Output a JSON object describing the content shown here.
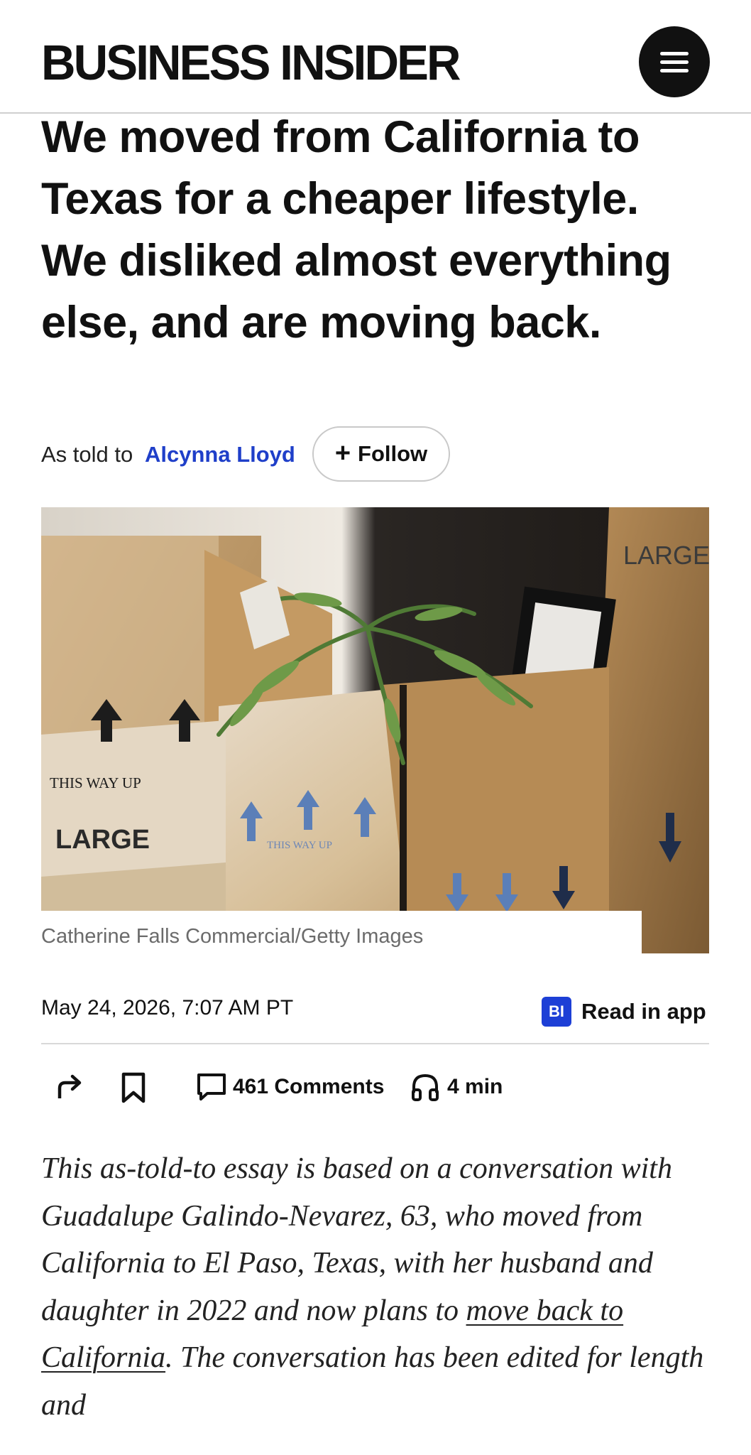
{
  "header": {
    "logo_text": "BUSINESS INSIDER",
    "menu_icon": "hamburger-menu-icon"
  },
  "article": {
    "headline": "We moved from California to Texas for a cheaper lifestyle. We disliked almost everything else, and are moving back.",
    "byline_prefix": "As told to",
    "author": "Alcynna Lloyd",
    "follow_label": "Follow",
    "photo_text": {
      "large_top": "LARGE",
      "this_way_up": "THIS WAY UP",
      "large_left": "LARGE",
      "this_way_up_small": "THIS WAY UP"
    },
    "image_caption": "Catherine Falls Commercial/Getty Images",
    "date": "May 24, 2026, 7:07 AM PT",
    "read_in_app_badge": "BI",
    "read_in_app_label": "Read in app",
    "comments_label": "461 Comments",
    "listen_label": "4 min",
    "intro": {
      "part1": "This as-told-to essay is based on a conversation with Guadalupe Galindo-Nevarez, 63, who moved from California to El Paso, Texas, with her husband and daughter in 2022 and now plans to ",
      "link": "move back to California",
      "part2": ". The conversation has been edited for length and"
    }
  },
  "colors": {
    "accent_link": "#1f3fc9",
    "bi_badge": "#1d3fd6",
    "text": "#111111",
    "caption": "#6b6b6b"
  },
  "icons": [
    "hamburger-menu-icon",
    "share-icon",
    "bookmark-icon",
    "comment-icon",
    "headphones-icon"
  ]
}
